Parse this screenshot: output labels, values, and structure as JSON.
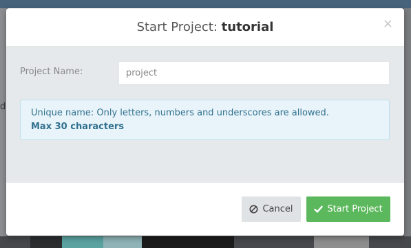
{
  "dialog": {
    "title_prefix": "Start Project:",
    "title_name": "tutorial",
    "close_glyph": "×"
  },
  "form": {
    "label": "Project Name:",
    "input_value": "",
    "input_placeholder": "project"
  },
  "info": {
    "message": "Unique name: Only letters, numbers and underscores are allowed.",
    "note": "Max 30 characters"
  },
  "footer": {
    "cancel_label": "Cancel",
    "cancel_icon": "ban-icon",
    "start_label": "Start Project",
    "start_icon": "check-icon"
  },
  "background": {
    "left_fragment": "d"
  },
  "colors": {
    "primary_button": "#5cb85c",
    "info_text": "#31708f",
    "info_bg": "#e8f4f9"
  }
}
